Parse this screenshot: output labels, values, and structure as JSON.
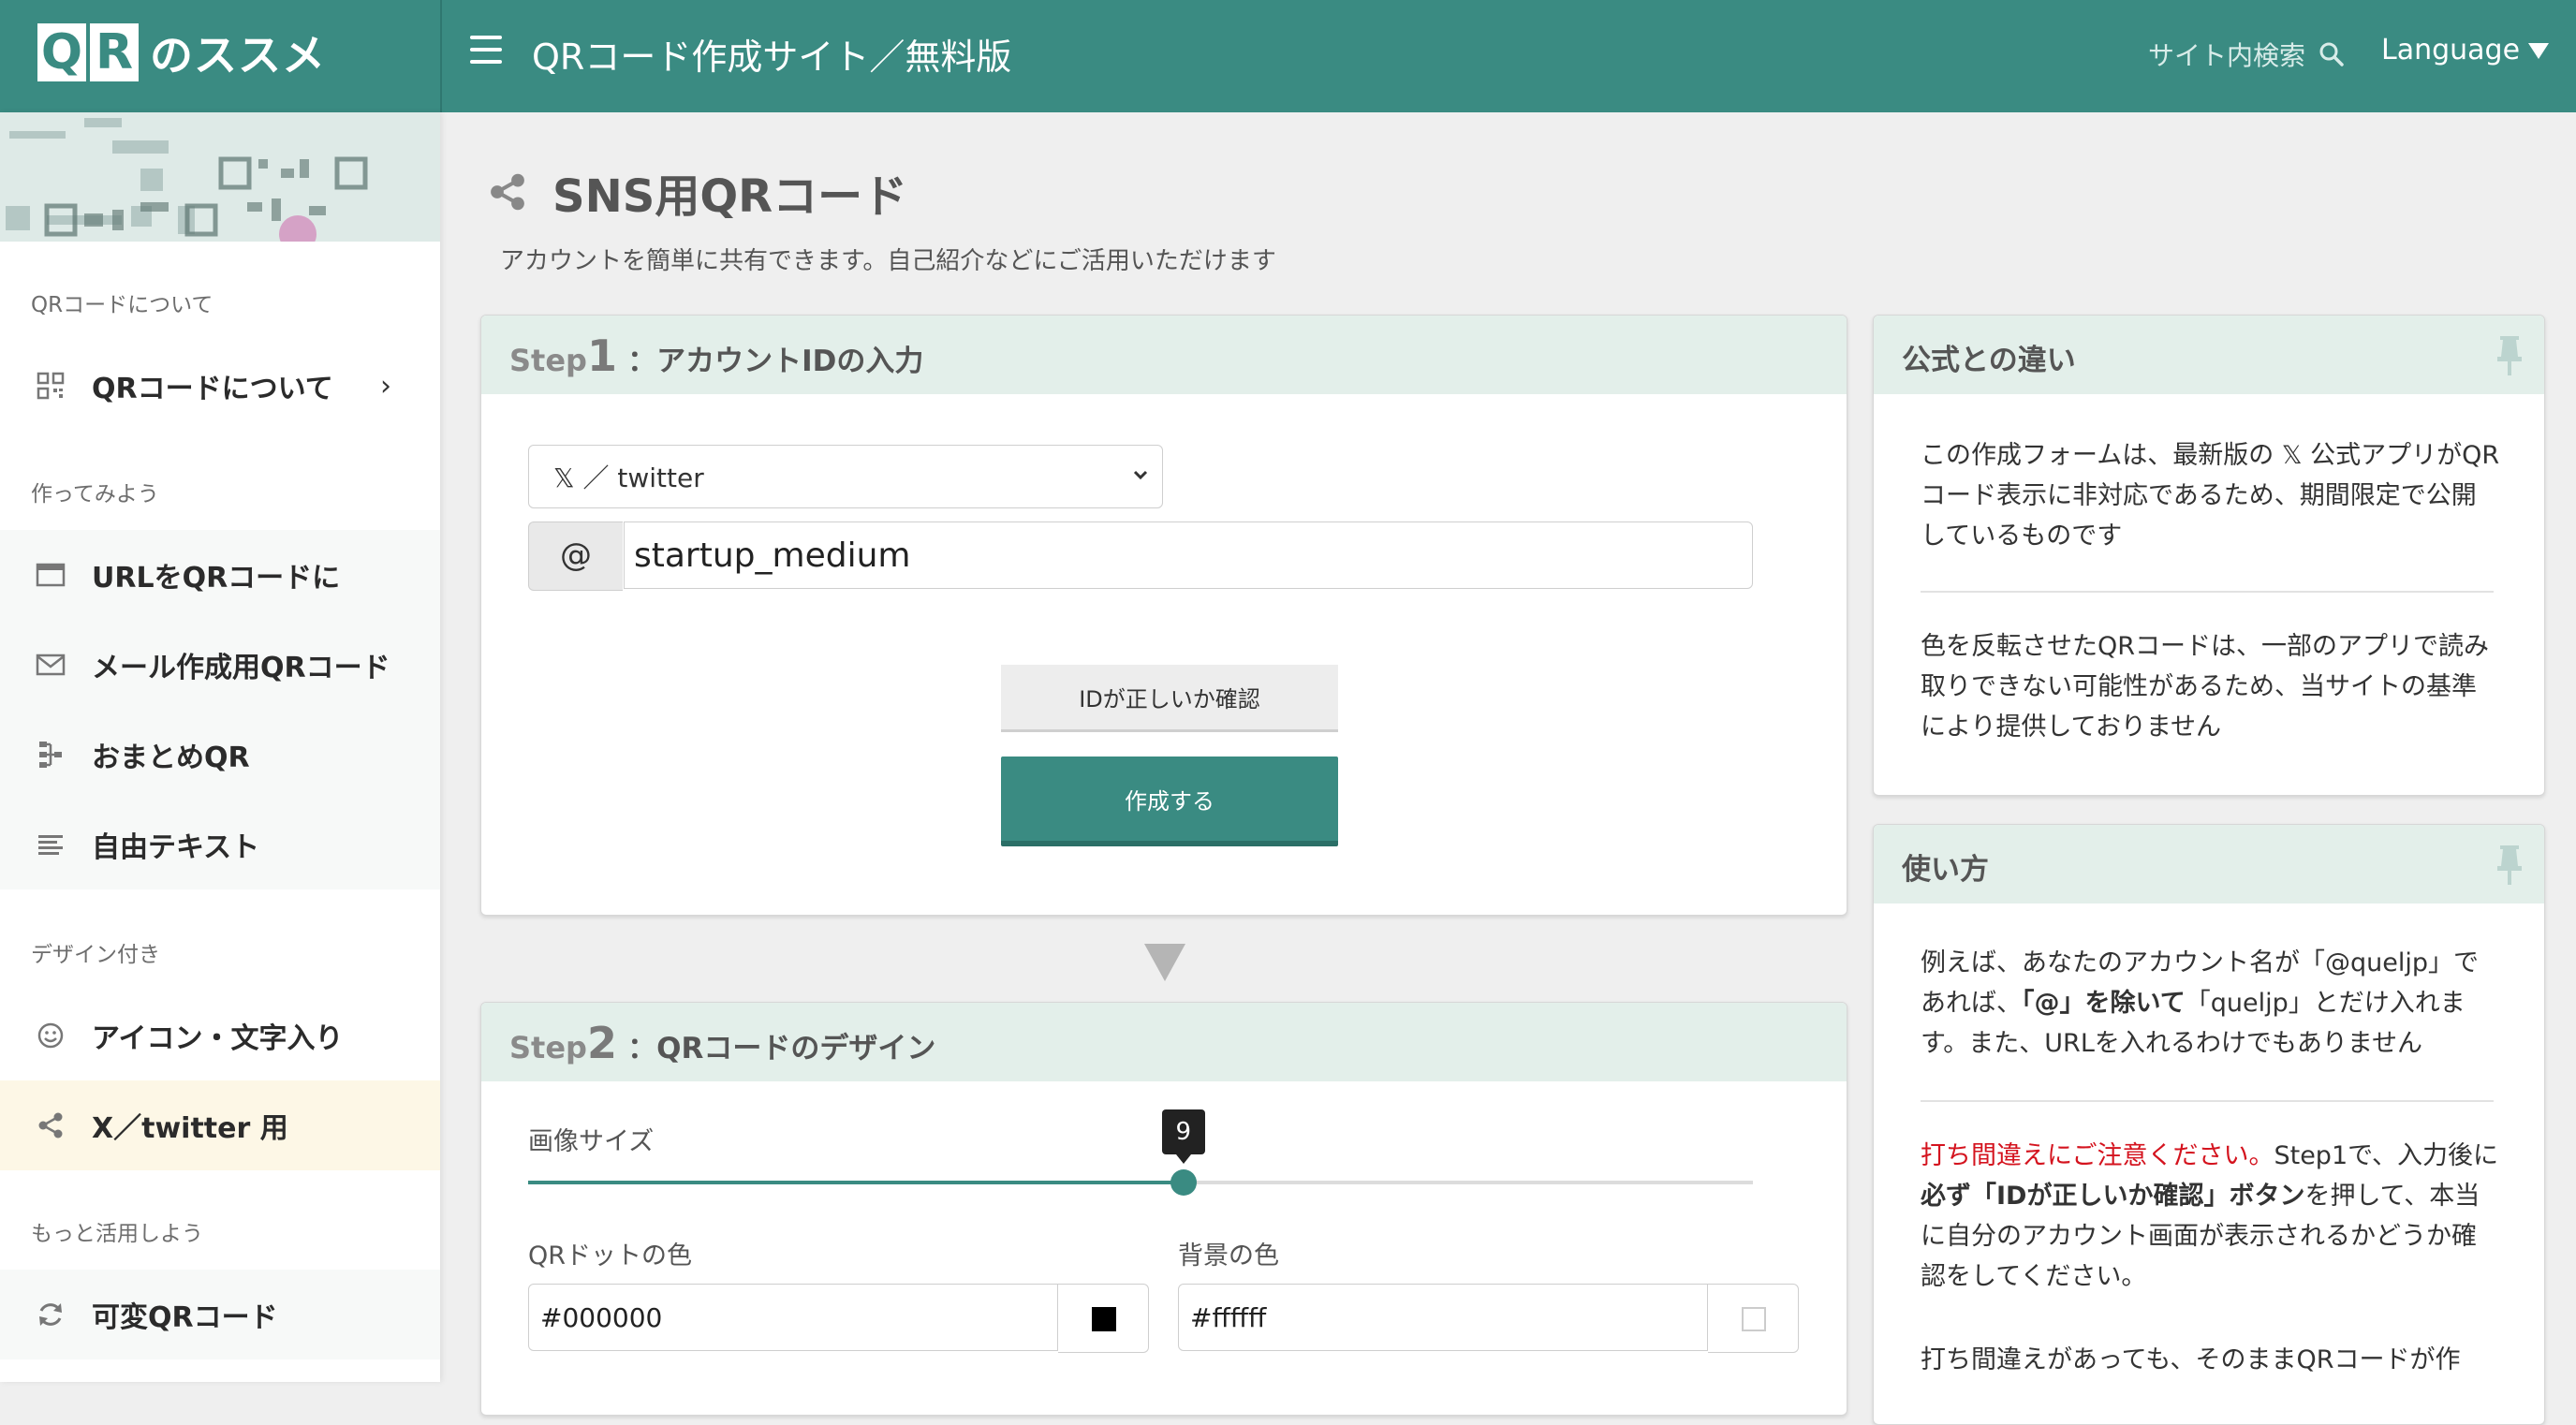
{
  "header": {
    "logo_qr": [
      "Q",
      "R"
    ],
    "logo_text": "のススメ",
    "site_title": "QRコード作成サイト／無料版",
    "site_search_label": "サイト内検索",
    "language_label": "Language"
  },
  "sidebar": {
    "sections": [
      {
        "title": "QRコードについて"
      },
      {
        "title": "作ってみよう"
      },
      {
        "title": "デザイン付き"
      },
      {
        "title": "もっと活用しよう"
      }
    ],
    "items": [
      {
        "label": "QRコードについて",
        "icon": "qr-icon",
        "chevron": "›"
      },
      {
        "label": "URLをQRコードに",
        "icon": "browser-window-icon"
      },
      {
        "label": "メール作成用QRコード",
        "icon": "envelope-icon"
      },
      {
        "label": "おまとめQR",
        "icon": "tree-icon"
      },
      {
        "label": "自由テキスト",
        "icon": "text-lines-icon"
      },
      {
        "label": "アイコン・文字入り",
        "icon": "smiley-icon"
      },
      {
        "label": "X／twitter 用",
        "icon": "share-icon",
        "active": true
      },
      {
        "label": "可変QRコード",
        "icon": "refresh-icon"
      }
    ]
  },
  "main": {
    "page_title": "SNS用QRコード",
    "page_subtitle": "アカウントを簡単に共有できます。自己紹介などにご活用いただけます",
    "step1": {
      "step_word": "Step",
      "step_number": "1",
      "separator": "：",
      "title": "アカウントIDの入力",
      "service_select_value": "𝕏 ／ twitter",
      "at_symbol": "@",
      "account_id_value": "startup_medium",
      "check_button": "IDが正しいか確認",
      "create_button": "作成する"
    },
    "step2": {
      "step_word": "Step",
      "step_number": "2",
      "separator": "：",
      "title": "QRコードのデザイン",
      "size_label": "画像サイズ",
      "size_value": "9",
      "size_fraction": 0.535,
      "dot_color_label": "QRドットの色",
      "dot_color_value": "#000000",
      "bg_color_label": "背景の色",
      "bg_color_value": "#ffffff"
    }
  },
  "right": {
    "difference": {
      "title": "公式との違い",
      "para1": "この作成フォームは、最新版の 𝕏 公式アプリがQRコード表示に非対応であるため、期間限定で公開しているものです",
      "para2": "色を反転させたQRコードは、一部のアプリで読み取りできない可能性があるため、当サイトの基準により提供しておりません"
    },
    "howto": {
      "title": "使い方",
      "para1_a": "例えば、あなたのアカウント名が「@queljp」であれば、",
      "para1_bold": "「@」を除いて",
      "para1_b": "「queljp」とだけ入れます。また、URLを入れるわけでもありません",
      "para2_red": "打ち間違えにご注意ください。",
      "para2_a": "Step1で、入力後に",
      "para2_bold": "必ず「IDが正しいか確認」ボタン",
      "para2_b": "を押して、本当に自分のアカウント画面が表示されるかどうか確認をしてください。",
      "para3": "打ち間違えがあっても、そのままQRコードが作"
    }
  },
  "colors": {
    "brand": "#3a8b82",
    "card_header": "#e3efea",
    "active_item": "#fdf7e6",
    "warning_red": "#d4131e"
  }
}
